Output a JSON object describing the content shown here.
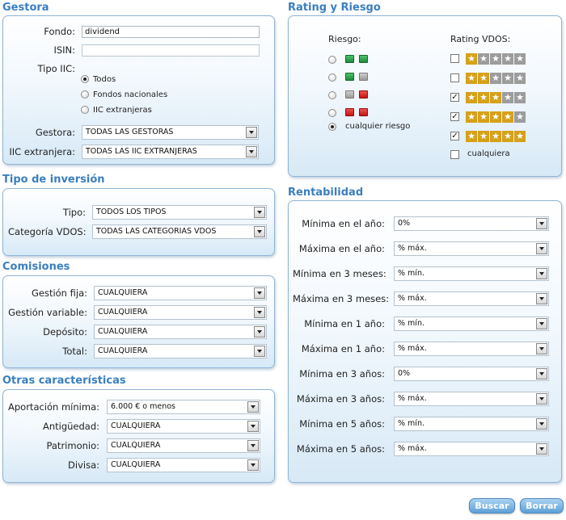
{
  "gestora": {
    "title": "Gestora",
    "fondo_label": "Fondo:",
    "fondo_value": "dividend",
    "isin_label": "ISIN:",
    "isin_value": "",
    "tipo_iic_label": "Tipo IIC:",
    "tipo_options": [
      "Todos",
      "Fondos nacionales",
      "IIC extranjeras"
    ],
    "tipo_selected": 0,
    "gestora_label": "Gestora:",
    "gestora_value": "TODAS LAS GESTORAS",
    "iic_ext_label": "IIC extranjera:",
    "iic_ext_value": "TODAS LAS IIC EXTRANJERAS"
  },
  "tipo_inversion": {
    "title": "Tipo de inversión",
    "tipo_label": "Tipo:",
    "tipo_value": "TODOS LOS TIPOS",
    "categoria_label": "Categoría VDOS:",
    "categoria_value": "TODAS LAS CATEGORIAS VDOS"
  },
  "comisiones": {
    "title": "Comisiones",
    "rows": [
      {
        "label": "Gestión fija:",
        "value": "CUALQUIERA"
      },
      {
        "label": "Gestión variable:",
        "value": "CUALQUIERA"
      },
      {
        "label": "Depósito:",
        "value": "CUALQUIERA"
      },
      {
        "label": "Total:",
        "value": "CUALQUIERA"
      }
    ]
  },
  "otras": {
    "title": "Otras características",
    "rows": [
      {
        "label": "Aportación mínima:",
        "value": "6.000 € o menos"
      },
      {
        "label": "Antigüedad:",
        "value": "CUALQUIERA"
      },
      {
        "label": "Patrimonio:",
        "value": "CUALQUIERA"
      },
      {
        "label": "Divisa:",
        "value": "CUALQUIERA"
      }
    ]
  },
  "rating": {
    "title": "Rating y Riesgo",
    "riesgo_label": "Riesgo:",
    "rating_label": "Rating VDOS:",
    "riesgo_selected": 4,
    "riesgo_rows": [
      {
        "colors": [
          "green",
          "green"
        ]
      },
      {
        "colors": [
          "green",
          "gray"
        ]
      },
      {
        "colors": [
          "gray",
          "red"
        ]
      },
      {
        "colors": [
          "red",
          "red"
        ]
      }
    ],
    "cualquier_riesgo": "cualquier riesgo",
    "rating_rows": [
      {
        "stars": 1,
        "checked": false
      },
      {
        "stars": 2,
        "checked": false
      },
      {
        "stars": 3,
        "checked": true
      },
      {
        "stars": 4,
        "checked": true
      },
      {
        "stars": 5,
        "checked": true
      }
    ],
    "cualquiera": "cualquiera",
    "cualquiera_checked": false,
    "colors": {
      "gold": "#d6a11a",
      "grey": "#9c9c9c",
      "green": "#2ea84a",
      "red": "#d92020"
    }
  },
  "rentabilidad": {
    "title": "Rentabilidad",
    "rows": [
      {
        "label": "Mínima en el año:",
        "value": "0%"
      },
      {
        "label": "Máxima en el año:",
        "value": "% máx."
      },
      {
        "label": "Mínima en 3 meses:",
        "value": "% mín."
      },
      {
        "label": "Máxima en 3 meses:",
        "value": "% máx."
      },
      {
        "label": "Mínima en 1 año:",
        "value": "% mín."
      },
      {
        "label": "Máxima en 1 año:",
        "value": "% máx."
      },
      {
        "label": "Mínima en 3 años:",
        "value": "0%"
      },
      {
        "label": "Máxima en 3 años:",
        "value": "% máx."
      },
      {
        "label": "Mínima en 5 años:",
        "value": "% mín."
      },
      {
        "label": "Máxima en 5 años:",
        "value": "% máx."
      }
    ]
  },
  "buttons": {
    "buscar": "Buscar",
    "borrar": "Borrar"
  },
  "theme": {
    "title_color": "#3a7fc0",
    "panel_border": "#8fb4d4"
  }
}
